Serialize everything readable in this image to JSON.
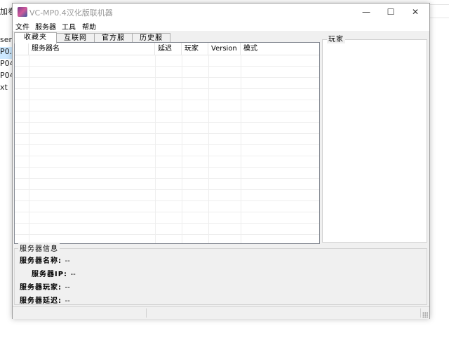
{
  "background": {
    "crumb": "加卷",
    "side_items": [
      "ser",
      "P0.4",
      "P04_",
      "P04_",
      "xt"
    ],
    "selected_index": 1
  },
  "window": {
    "title": "VC-MP0.4汉化版联机器",
    "controls": {
      "minimize": "—",
      "maximize": "☐",
      "close": "✕"
    }
  },
  "menu": [
    "文件",
    "服务器",
    "工具",
    "帮助"
  ],
  "tabs": [
    {
      "label": "收藏夹",
      "active": true
    },
    {
      "label": "互联网",
      "active": false
    },
    {
      "label": "官方服",
      "active": false
    },
    {
      "label": "历史服",
      "active": false
    }
  ],
  "server_table": {
    "columns": [
      "",
      "服务器名",
      "延迟",
      "玩家",
      "Version",
      "模式"
    ],
    "rows": []
  },
  "players_panel": {
    "title": "玩家"
  },
  "server_info": {
    "title": "服务器信息",
    "fields": [
      {
        "label": "服务器名称:",
        "value": "--"
      },
      {
        "label": "服务器IP:",
        "value": "--"
      },
      {
        "label": "服务器玩家:",
        "value": "--"
      },
      {
        "label": "服务器延迟:",
        "value": "--"
      }
    ]
  }
}
